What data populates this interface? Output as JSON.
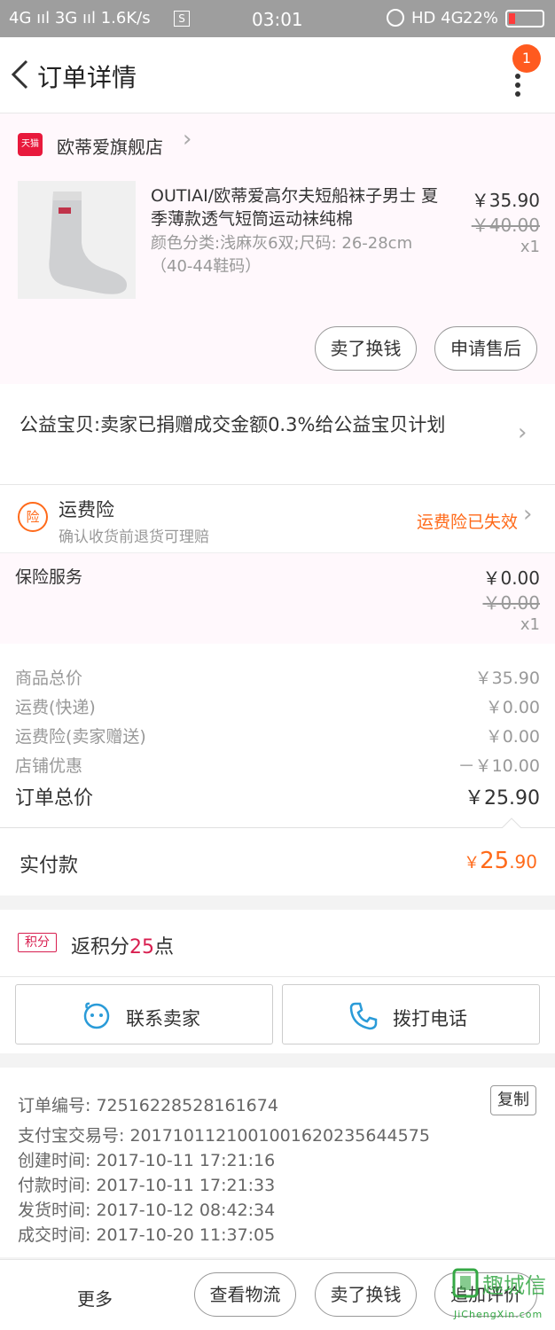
{
  "status_bar": {
    "left": "4G ııl  3G ııl  1.6K/s",
    "time": "03:01",
    "right": "HD 4G",
    "battery": "22%"
  },
  "nav": {
    "title": "订单详情",
    "badge_count": "1"
  },
  "shop": {
    "logo_text": "天猫",
    "name": "欧蒂爱旗舰店"
  },
  "product": {
    "title": "OUTIAI/欧蒂爱高尔夫短船袜子男士 夏季薄款透气短筒运动袜纯棉",
    "spec": "颜色分类:浅麻灰6双;尺码: 26-28cm（40-44鞋码）",
    "price": "￥35.90",
    "original_price": "￥40.00",
    "quantity": "x1",
    "actions": [
      "卖了换钱",
      "申请售后"
    ]
  },
  "charity": {
    "text": "公益宝贝:卖家已捐赠成交金额0.3%给公益宝贝计划"
  },
  "freight_insurance": {
    "icon_text": "险",
    "title": "运费险",
    "subtitle": "确认收货前退货可理赔",
    "status": "运费险已失效"
  },
  "insurance_service": {
    "label": "保险服务",
    "price": "￥0.00",
    "original_price": "￥0.00",
    "quantity": "x1"
  },
  "totals": {
    "rows": [
      {
        "label": "商品总价",
        "value": "￥35.90"
      },
      {
        "label": "运费(快递)",
        "value": "￥0.00"
      },
      {
        "label": "运费险(卖家赠送)",
        "value": "￥0.00"
      },
      {
        "label": "店铺优惠",
        "value": "－￥10.00"
      }
    ],
    "order_total_label": "订单总价",
    "order_total_value": "￥25.90",
    "paid_label": "实付款",
    "paid_currency": "￥",
    "paid_int": "25",
    "paid_dec": ".90"
  },
  "points": {
    "tag": "积分",
    "prefix": "返积分",
    "count": "25",
    "suffix": "点"
  },
  "contact": {
    "seller_label": "联系卖家",
    "call_label": "拨打电话"
  },
  "order_info": {
    "lines": [
      "订单编号: 72516228528161674",
      "支付宝交易号: 2017101121001001620235644575",
      "创建时间: 2017-10-11 17:21:16",
      "付款时间: 2017-10-11 17:21:33",
      "发货时间: 2017-10-12 08:42:34",
      "成交时间: 2017-10-20 11:37:05"
    ],
    "copy_label": "复制"
  },
  "bottom_bar": {
    "more_label": "更多",
    "buttons": [
      "查看物流",
      "卖了换钱",
      "追加评价"
    ]
  },
  "watermark": {
    "text": "趣城信",
    "url": "JiChengXin.com"
  },
  "colors": {
    "accent_orange": "#ff6a1a",
    "tmall_red": "#e8193c",
    "points_red": "#d81e4f",
    "badge": "#ff5a1f",
    "call_blue": "#2a9bd8"
  }
}
